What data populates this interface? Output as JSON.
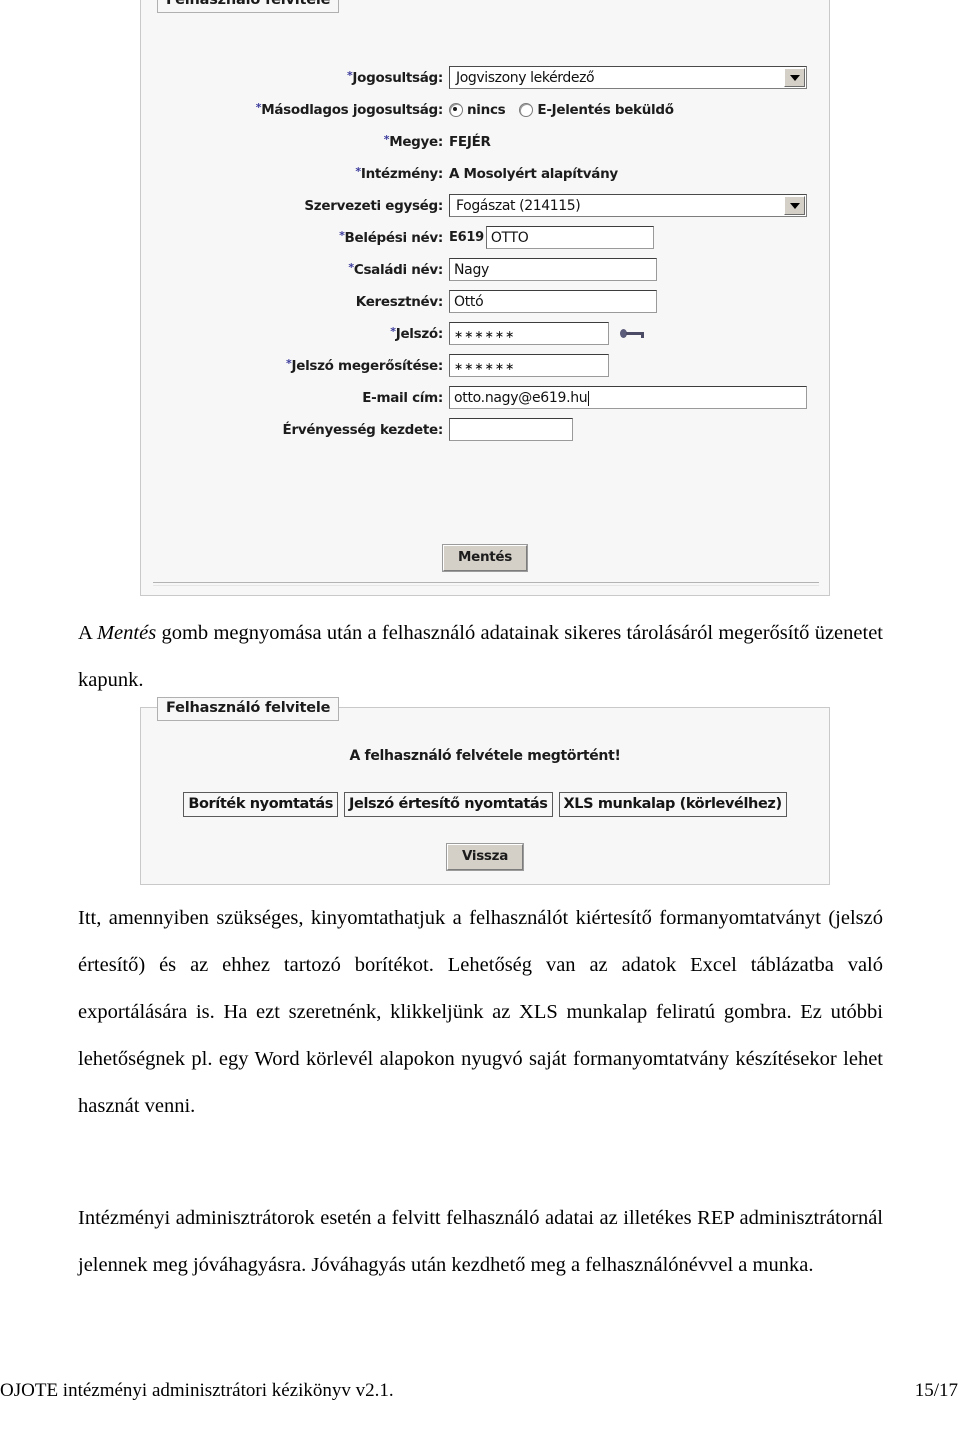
{
  "screenshot1": {
    "legend": "Felhasználó felvitele",
    "fields": {
      "jogosultsag_label": "Jogosultság:",
      "jogosultsag_value": "Jogviszony lekérdező",
      "masodlagos_label": "Másodlagos jogosultság:",
      "radio_nincs": "nincs",
      "radio_ejelentes": "E-Jelentés beküldő",
      "megye_label": "Megye:",
      "megye_value": "FEJÉR",
      "intezmeny_label": "Intézmény:",
      "intezmeny_value": "A Mosolyért alapítvány",
      "szervezeti_label": "Szervezeti egység:",
      "szervezeti_value": "Fogászat (214115)",
      "belepesi_label": "Belépési név:",
      "belepesi_prefix": "E619",
      "belepesi_value": "OTTO",
      "csaladi_label": "Családi név:",
      "csaladi_value": "Nagy",
      "keresztnev_label": "Keresztnév:",
      "keresztnev_value": "Ottó",
      "jelszo_label": "Jelszó:",
      "jelszo_value": "∗∗∗∗∗∗",
      "jelszo_meg_label": "Jelszó megerősítése:",
      "jelszo_meg_value": "∗∗∗∗∗∗",
      "email_label": "E-mail cím:",
      "email_value": "otto.nagy@e619.hu",
      "ervenyesseg_label": "Érvényesség kezdete:",
      "ervenyesseg_value": ""
    },
    "save_button": "Mentés"
  },
  "screenshot2": {
    "legend": "Felhasználó felvitele",
    "message": "A felhasználó felvétele megtörtént!",
    "buttons": [
      "Boríték nyomtatás",
      "Jelszó értesítő nyomtatás",
      "XLS munkalap (körlevélhez)"
    ],
    "back_button": "Vissza"
  },
  "body": {
    "p1_before": "A ",
    "p1_italic": "Mentés",
    "p1_after": " gomb megnyomása után a felhasználó adatainak sikeres tárolásáról megerősítő üzenetet kapunk.",
    "p2": "Itt, amennyiben szükséges, kinyomtathatjuk a felhasználót kiértesítő formanyomtatványt (jelszó értesítő) és az ehhez tartozó borítékot. Lehetőség van az adatok Excel táblázatba való exportálására is. Ha ezt szeretnénk, klikkeljünk az XLS munkalap feliratú gombra. Ez utóbbi lehetőségnek pl. egy Word körlevél alapokon nyugvó saját formanyomtatvány készítésekor lehet hasznát venni.",
    "p3": "Intézményi adminisztrátorok esetén a felvitt felhasználó adatai az illetékes REP adminisztrátornál jelennek meg jóváhagyásra. Jóváhagyás után kezdhető meg a felhasználónévvel a munka."
  },
  "footer": {
    "left": "OJOTE intézményi adminisztrátori kézikönyv v2.1.",
    "right": "15/17"
  },
  "colors": {
    "required_asterisk": "#3a3a9c",
    "panel_bg": "#f7f7f7",
    "button_face": "#d4d0c8"
  }
}
